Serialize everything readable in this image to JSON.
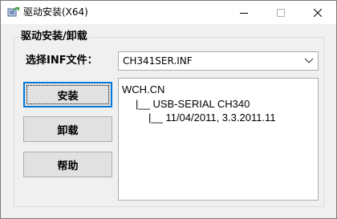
{
  "window": {
    "title": "驱动安装(X64)"
  },
  "titlebar": {
    "icons": {
      "app": "installer-icon",
      "minimize": "minimize-icon",
      "maximize": "maximize-icon",
      "close": "close-icon"
    }
  },
  "group": {
    "label": "驱动安装/卸载"
  },
  "inf": {
    "label": "选择INF文件：",
    "selected": "CH341SER.INF"
  },
  "buttons": {
    "install": "安装",
    "uninstall": "卸载",
    "help": "帮助"
  },
  "info": {
    "lines": [
      "WCH.CN",
      "|__ USB-SERIAL CH340",
      "|__ 11/04/2011, 3.3.2011.11"
    ]
  },
  "colors": {
    "window_bg": "#f0f0f0",
    "focus_border": "#0078d7",
    "button_bg": "#e1e1e1"
  }
}
